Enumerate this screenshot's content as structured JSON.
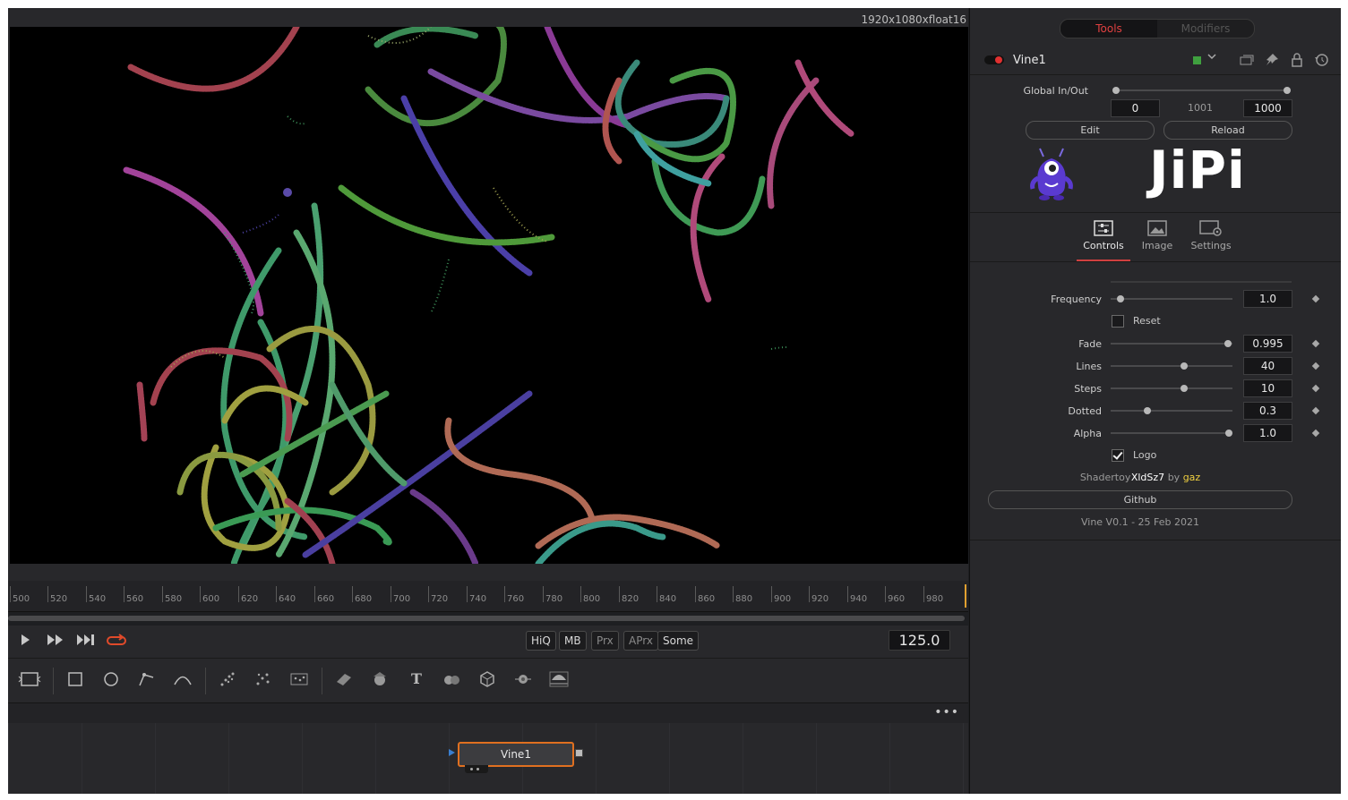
{
  "viewer": {
    "resolution_label": "1920x1080xfloat16"
  },
  "timeline": {
    "ticks": [
      "500",
      "520",
      "540",
      "560",
      "580",
      "600",
      "620",
      "640",
      "660",
      "680",
      "700",
      "720",
      "740",
      "760",
      "780",
      "800",
      "820",
      "840",
      "860",
      "880",
      "900",
      "920",
      "940",
      "960",
      "980"
    ]
  },
  "transport": {
    "play_icon": "play-icon",
    "ff_icon": "fast-forward-icon",
    "end_icon": "skip-to-end-icon",
    "loop_icon": "loop-icon",
    "modes": [
      "HiQ",
      "MB",
      "Prx",
      "APrx",
      "Some"
    ],
    "current_frame": "125.0"
  },
  "toolbar": {
    "tools": [
      "background-icon",
      "rectangle-mask-icon",
      "ellipse-mask-icon",
      "polygon-mask-icon",
      "bspline-mask-icon",
      "particle-emitter-icon",
      "particle-render-icon",
      "particle-shape-icon",
      "image-plane-3d-icon",
      "shape-3d-icon",
      "text-3d-icon",
      "merge-3d-icon",
      "renderer-3d-icon",
      "camera-3d-icon",
      "spotlight-icon"
    ]
  },
  "node": {
    "name": "Vine1"
  },
  "inspector": {
    "tabs": {
      "tools": "Tools",
      "modifiers": "Modifiers"
    },
    "tool_name": "Vine1",
    "global_label": "Global In/Out",
    "global_in": "0",
    "global_mid": "1001",
    "global_out": "1000",
    "edit_label": "Edit",
    "reload_label": "Reload",
    "logo_text": "JiPi",
    "subtabs": {
      "controls": "Controls",
      "image": "Image",
      "settings": "Settings"
    },
    "params": {
      "frequency": {
        "label": "Frequency",
        "value": "1.0",
        "level": 0.08
      },
      "reset": {
        "label": "Reset"
      },
      "fade": {
        "label": "Fade",
        "value": "0.995",
        "level": 0.96
      },
      "lines": {
        "label": "Lines",
        "value": "40",
        "level": 0.6
      },
      "steps": {
        "label": "Steps",
        "value": "10",
        "level": 0.6
      },
      "dotted": {
        "label": "Dotted",
        "value": "0.3",
        "level": 0.3
      },
      "alpha": {
        "label": "Alpha",
        "value": "1.0",
        "level": 0.97
      },
      "logo": {
        "label": "Logo",
        "checked": true
      }
    },
    "credit": {
      "prefix": "Shadertoy",
      "id": "XldSz7",
      "by": "by",
      "author": "gaz"
    },
    "github_label": "Github",
    "version": "Vine V0.1 - 25 Feb 2021"
  },
  "colors": {
    "accent": "#e04040",
    "node_border": "#e07020",
    "credit_link": "#f0d040"
  }
}
